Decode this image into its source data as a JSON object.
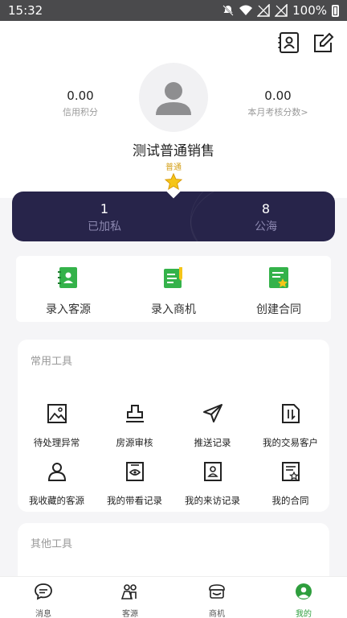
{
  "status_bar": {
    "time": "15:32",
    "battery": "100%"
  },
  "profile": {
    "credit_value": "0.00",
    "credit_label": "信用积分",
    "assessment_value": "0.00",
    "assessment_label": "本月考核分数>",
    "name": "测试普通销售",
    "level": "普通"
  },
  "summary": {
    "private_count": "1",
    "private_label": "已加私",
    "public_count": "8",
    "public_label": "公海"
  },
  "quick_actions": [
    {
      "label": "录入客源"
    },
    {
      "label": "录入商机"
    },
    {
      "label": "创建合同"
    }
  ],
  "common_tools": {
    "title": "常用工具",
    "items": [
      {
        "label": "待处理异常"
      },
      {
        "label": "房源审核"
      },
      {
        "label": "推送记录"
      },
      {
        "label": "我的交易客户"
      },
      {
        "label": "我收藏的客源"
      },
      {
        "label": "我的带看记录"
      },
      {
        "label": "我的来访记录"
      },
      {
        "label": "我的合同"
      }
    ]
  },
  "other_tools": {
    "title": "其他工具"
  },
  "tabbar": {
    "items": [
      {
        "label": "消息"
      },
      {
        "label": "客源"
      },
      {
        "label": "商机"
      },
      {
        "label": "我的"
      }
    ],
    "active_color": "#2e9e3d"
  },
  "colors": {
    "dark_card": "#27244a",
    "accent_green": "#2e9e3d",
    "level_gold": "#d4a019"
  }
}
